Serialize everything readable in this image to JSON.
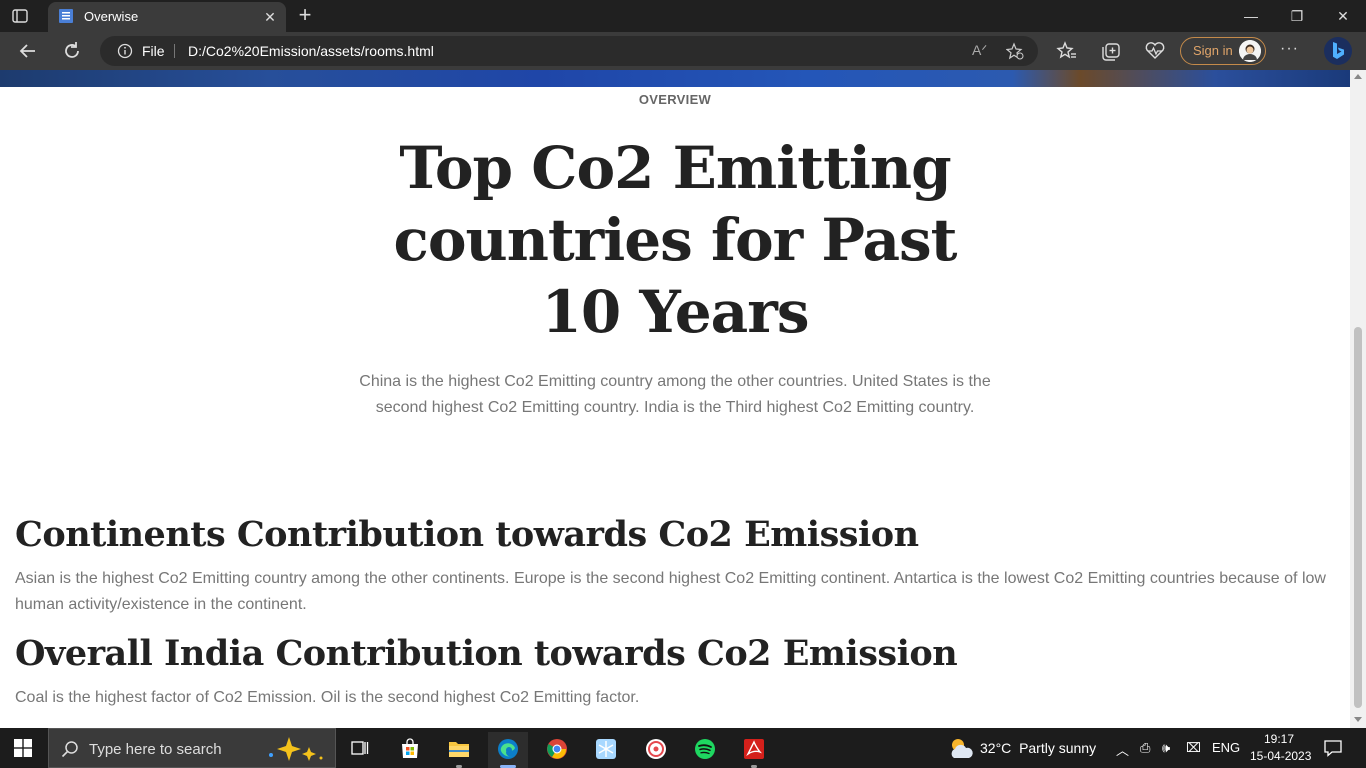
{
  "browser": {
    "tab": {
      "title": "Overwise"
    },
    "address": {
      "scheme_label": "File",
      "url": "D:/Co2%20Emission/assets/rooms.html"
    },
    "signin_label": "Sign in"
  },
  "page": {
    "overview_label": "OVERVIEW",
    "title": "Top Co2 Emitting countries for Past 10 Years",
    "description": "China is the highest Co2 Emitting country among the other countries. United States is the second highest Co2 Emitting country. India is the Third highest Co2 Emitting country.",
    "sections": [
      {
        "heading": "Continents Contribution towards Co2 Emission",
        "text": "Asian is the highest Co2 Emitting country among the other continents. Europe is the second highest Co2 Emitting continent. Antartica is the lowest Co2 Emitting countries because of low human activity/existence in the continent."
      },
      {
        "heading": "Overall India Contribution towards Co2 Emission",
        "text": "Coal is the highest factor of Co2 Emission. Oil is the second highest Co2 Emitting factor."
      }
    ]
  },
  "taskbar": {
    "search_placeholder": "Type here to search",
    "apps": [
      "task-view",
      "microsoft-store",
      "file-explorer",
      "edge",
      "chrome",
      "snipping-tool",
      "app-red-circle",
      "spotify",
      "acrobat"
    ],
    "weather": {
      "temp": "32°C",
      "condition": "Partly sunny"
    },
    "language": "ENG",
    "time": "19:17",
    "date": "15-04-2023"
  },
  "colors": {
    "accent_edge": "#0078d4",
    "signin_border": "#c48a4a",
    "text_muted": "#777777",
    "heading": "#222222"
  }
}
